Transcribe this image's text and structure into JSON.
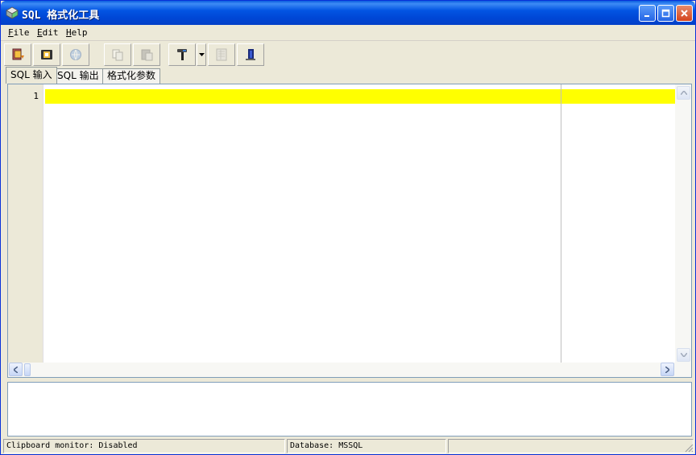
{
  "window": {
    "title": "SQL 格式化工具"
  },
  "menu": [
    {
      "key": "F",
      "rest": "ile"
    },
    {
      "key": "E",
      "rest": "dit"
    },
    {
      "key": "H",
      "rest": "elp"
    }
  ],
  "tabs": [
    {
      "label": "SQL 输入",
      "active": true
    },
    {
      "label": "SQL 输出",
      "active": false
    },
    {
      "label": "格式化参数",
      "active": false
    }
  ],
  "editor": {
    "line_number": "1"
  },
  "status": {
    "clipboard": "Clipboard monitor: Disabled",
    "database": "Database: MSSQL",
    "extra": ""
  },
  "colors": {
    "highlight": "#ffff00",
    "titlebar": "#0047d6"
  }
}
